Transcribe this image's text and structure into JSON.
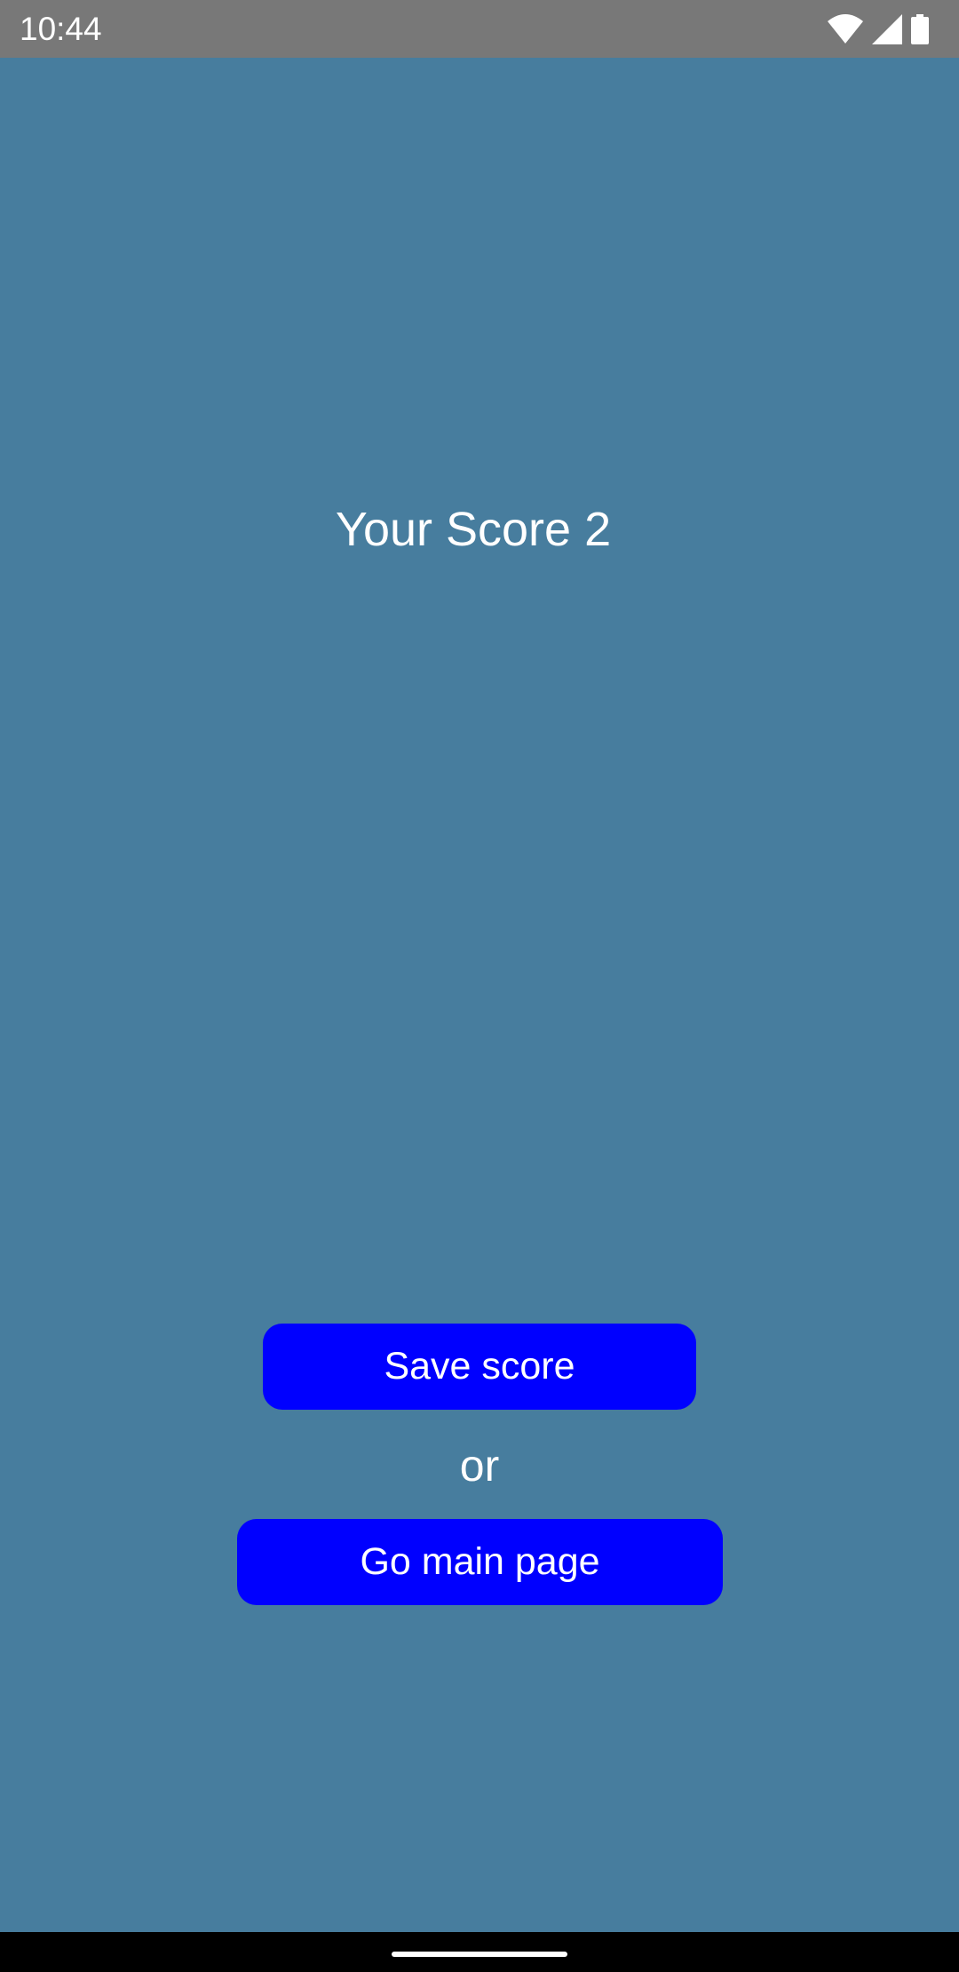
{
  "status_bar": {
    "time": "10:44",
    "icons": [
      "wifi-icon",
      "signal-icon",
      "battery-icon"
    ]
  },
  "score": {
    "label": "Your Score 2"
  },
  "actions": {
    "save_label": "Save score",
    "or_label": "or",
    "main_label": "Go main page"
  },
  "colors": {
    "background": "#477d9e",
    "status_bar": "#787878",
    "button": "#0000ff",
    "text": "#ffffff",
    "nav_bar": "#000000"
  }
}
